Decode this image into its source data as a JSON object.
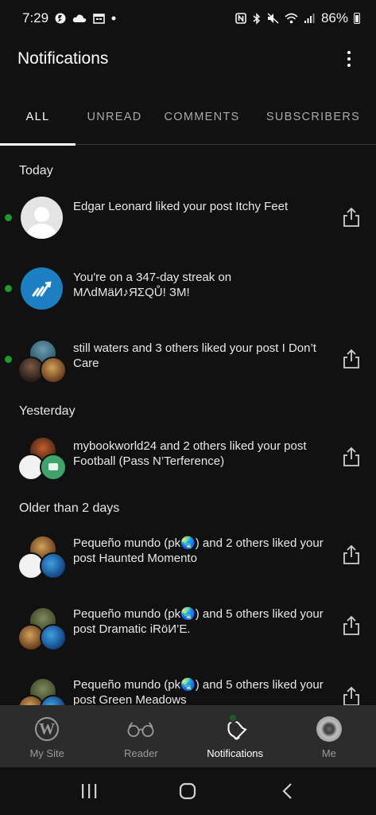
{
  "status_bar": {
    "time": "7:29",
    "battery": "86%"
  },
  "header": {
    "title": "Notifications"
  },
  "tabs": [
    {
      "label": "ALL",
      "active": true
    },
    {
      "label": "UNREAD",
      "active": false
    },
    {
      "label": "COMMENTS",
      "active": false
    },
    {
      "label": "SUBSCRIBERS",
      "active": false
    }
  ],
  "sections": {
    "today": "Today",
    "yesterday": "Yesterday",
    "older": "Older than 2 days"
  },
  "notifications": [
    {
      "text": "Edgar Leonard liked your post Itchy Feet",
      "unread": true
    },
    {
      "text": "You're on a 347-day streak on MΛdMäИ♪ЯΣQŮ! ЗM!",
      "unread": true
    },
    {
      "text": "still waters and 3 others liked your post I Don’t Care",
      "unread": true
    },
    {
      "text": "mybookworld24 and 2 others liked your post  Football (Pass N’Terference)",
      "unread": false
    },
    {
      "text": "Pequeño mundo (pk🌏) and 2 others liked your post Haunted Momento",
      "unread": false
    },
    {
      "text": "Pequeño mundo (pk🌏) and 5 others liked your post Dramatic iRöИ’E.",
      "unread": false
    },
    {
      "text": "Pequeño mundo (pk🌏) and 5 others liked your post Green Meadows",
      "unread": false
    }
  ],
  "bottom_nav": [
    {
      "label": "My Site",
      "icon": "wordpress-icon"
    },
    {
      "label": "Reader",
      "icon": "glasses-icon"
    },
    {
      "label": "Notifications",
      "icon": "bell-icon",
      "active": true
    },
    {
      "label": "Me",
      "icon": "avatar"
    }
  ],
  "colors": {
    "background": "#111111",
    "unread_dot": "#1f9a2e",
    "nav_background": "#2c2c2c",
    "streak_avatar": "#1c7fc2"
  }
}
